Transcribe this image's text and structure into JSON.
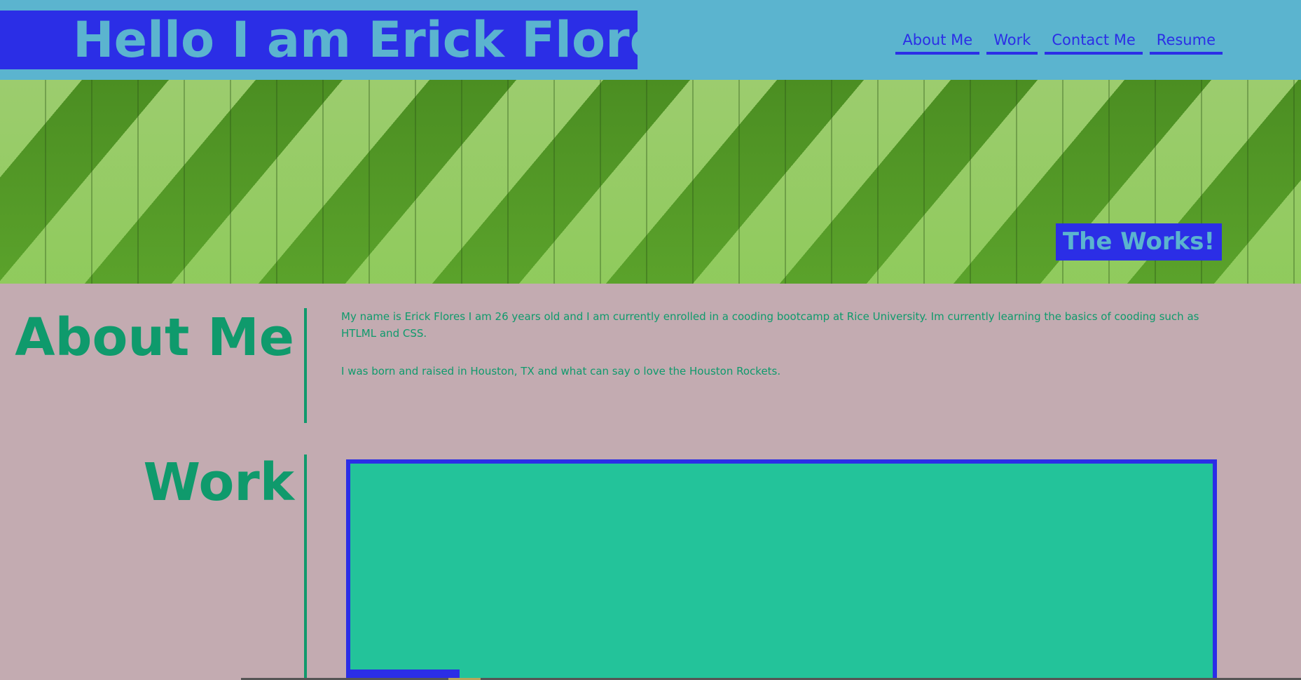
{
  "header": {
    "title": "Hello I am Erick Flores",
    "nav": [
      "About Me",
      "Work",
      "Contact Me",
      "Resume"
    ]
  },
  "hero": {
    "tag": "The Works!"
  },
  "about": {
    "heading": "About Me",
    "paragraphs": [
      "My name is Erick Flores I am 26 years old and I am currently enrolled in a cooding bootcamp at Rice University. Im currently learning the basics of cooding such as HTLML and CSS.",
      "I was born and raised in Houston, TX and what can say o love the Houston Rockets."
    ]
  },
  "work": {
    "heading": "Work"
  },
  "colors": {
    "page_background": "#c3abb1",
    "header_background": "#5bb4cf",
    "accent_blue": "#2b2ee6",
    "heading_green": "#0f9a6c",
    "card_teal": "#23c39a"
  }
}
